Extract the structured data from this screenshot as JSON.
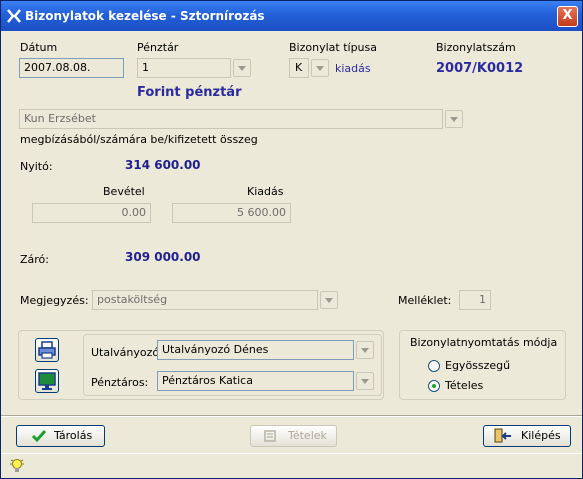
{
  "window": {
    "title": "Bizonylatok kezelése - Sztornírozás",
    "close_label": "X"
  },
  "header": {
    "date_label": "Dátum",
    "date_value": "2007.08.08.",
    "cashdesk_label": "Pénztár",
    "cashdesk_value": "1",
    "cashdesk_name": "Forint pénztár",
    "doctype_label": "Bizonylat típusa",
    "doctype_value": "K",
    "doctype_text": "kiadás",
    "docnum_label": "Bizonylatszám",
    "docnum_value": "2007/K0012"
  },
  "partner": {
    "name": "Kun Erzsébet",
    "caption": "megbízásából/számára  be/kifizetett összeg"
  },
  "amounts": {
    "opening_label": "Nyitó:",
    "opening_value": "314 600.00",
    "income_label": "Bevétel",
    "income_value": "0.00",
    "expense_label": "Kiadás",
    "expense_value": "5 600.00",
    "closing_label": "Záró:",
    "closing_value": "309 000.00"
  },
  "note": {
    "label": "Megjegyzés:",
    "value": "postaköltség",
    "attachment_label": "Melléklet:",
    "attachment_value": "1"
  },
  "people": {
    "approver_label": "Utalványozó:",
    "approver_value": "Utalványozó Dénes",
    "cashier_label": "Pénztáros:",
    "cashier_value": "Pénztáros Katica"
  },
  "print_mode": {
    "title": "Bizonylatnyomtatás módja",
    "options": [
      {
        "label": "Egyösszegű",
        "checked": false
      },
      {
        "label": "Tételes",
        "checked": true
      }
    ]
  },
  "buttons": {
    "save": "Tárolás",
    "items": "Tételek",
    "exit": "Kilépés"
  },
  "colors": {
    "titlebar": "#2360D8",
    "accent_text": "#2B2B9F",
    "window_bg": "#ECE9D8"
  },
  "icons": [
    "app-icon",
    "printer-icon",
    "monitor-icon",
    "checkmark-icon",
    "items-icon",
    "exit-door-icon",
    "lightbulb-icon"
  ]
}
